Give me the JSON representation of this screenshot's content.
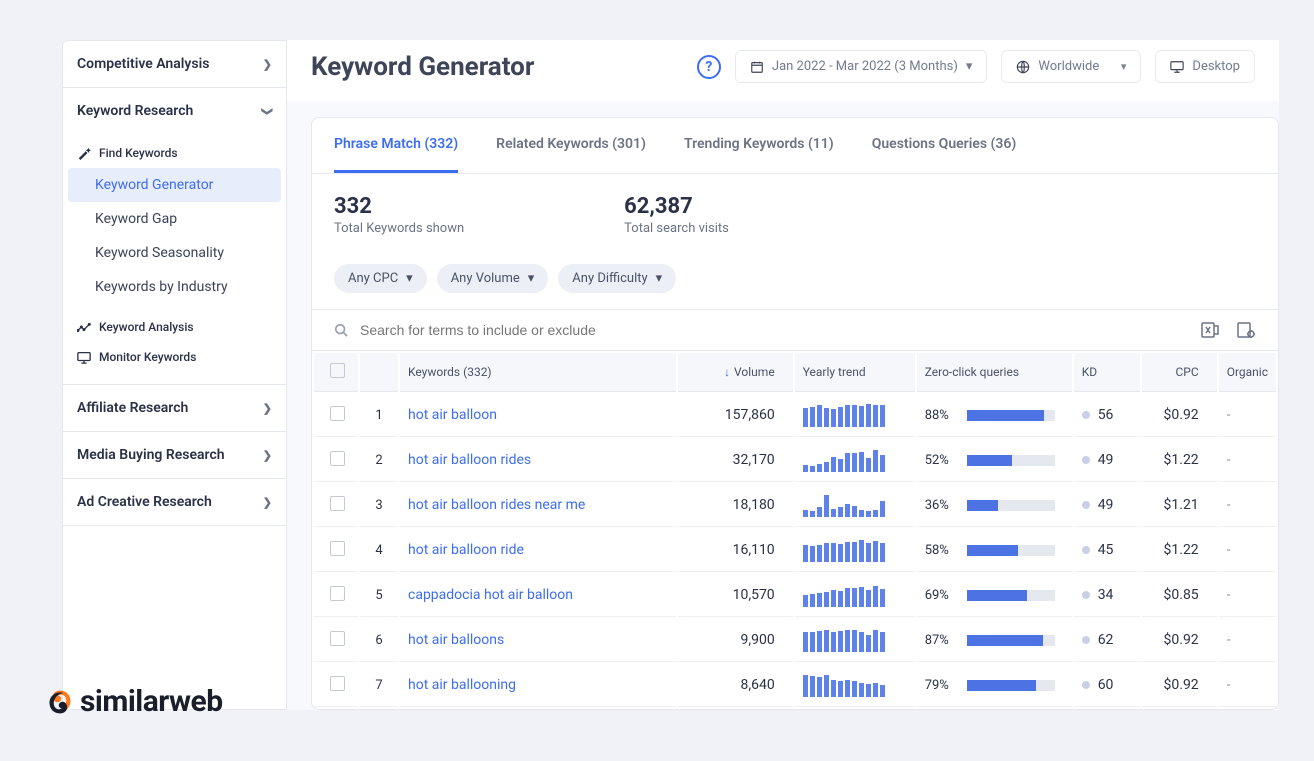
{
  "sidebar": {
    "sections": [
      {
        "label": "Competitive Analysis",
        "expanded": false
      },
      {
        "label": "Keyword Research",
        "expanded": true
      },
      {
        "label": "Affiliate Research",
        "expanded": false
      },
      {
        "label": "Media Buying Research",
        "expanded": false
      },
      {
        "label": "Ad Creative Research",
        "expanded": false
      }
    ],
    "findKeywords": {
      "groupLabel": "Find Keywords",
      "items": [
        "Keyword Generator",
        "Keyword Gap",
        "Keyword Seasonality",
        "Keywords by Industry"
      ],
      "active": "Keyword Generator"
    },
    "keywordAnalysis": "Keyword Analysis",
    "monitorKeywords": "Monitor Keywords"
  },
  "header": {
    "title": "Keyword Generator",
    "dateRange": "Jan 2022 - Mar 2022 (3 Months)",
    "region": "Worldwide",
    "device": "Desktop"
  },
  "tabs": [
    {
      "label": "Phrase Match (332)",
      "active": true
    },
    {
      "label": "Related Keywords (301)",
      "active": false
    },
    {
      "label": "Trending Keywords (11)",
      "active": false
    },
    {
      "label": "Questions Queries (36)",
      "active": false
    }
  ],
  "stats": {
    "totalKeywords": {
      "value": "332",
      "label": "Total Keywords shown"
    },
    "searchVisits": {
      "value": "62,387",
      "label": "Total search visits"
    }
  },
  "filters": [
    "Any CPC",
    "Any Volume",
    "Any Difficulty"
  ],
  "search": {
    "placeholder": "Search for terms to include or exclude"
  },
  "columns": {
    "keywords": "Keywords (332)",
    "volume": "Volume",
    "trend": "Yearly trend",
    "zero": "Zero-click queries",
    "kd": "KD",
    "cpc": "CPC",
    "organic": "Organic"
  },
  "rows": [
    {
      "rank": "1",
      "keyword": "hot air balloon",
      "volume": "157,860",
      "trend": [
        80,
        85,
        90,
        80,
        75,
        85,
        90,
        92,
        88,
        95,
        90,
        92
      ],
      "zero": 88,
      "kd": "56",
      "cpc": "$0.92"
    },
    {
      "rank": "2",
      "keyword": "hot air balloon rides",
      "volume": "32,170",
      "trend": [
        30,
        25,
        35,
        40,
        62,
        55,
        78,
        80,
        85,
        60,
        90,
        70
      ],
      "zero": 52,
      "kd": "49",
      "cpc": "$1.22"
    },
    {
      "rank": "3",
      "keyword": "hot air balloon rides near me",
      "volume": "18,180",
      "trend": [
        30,
        25,
        40,
        90,
        35,
        40,
        55,
        45,
        30,
        25,
        30,
        65
      ],
      "zero": 36,
      "kd": "49",
      "cpc": "$1.21"
    },
    {
      "rank": "4",
      "keyword": "hot air balloon ride",
      "volume": "16,110",
      "trend": [
        70,
        65,
        72,
        78,
        80,
        75,
        82,
        85,
        90,
        78,
        88,
        80
      ],
      "zero": 58,
      "kd": "45",
      "cpc": "$1.22"
    },
    {
      "rank": "5",
      "keyword": "cappadocia hot air balloon",
      "volume": "10,570",
      "trend": [
        50,
        55,
        60,
        62,
        70,
        65,
        78,
        80,
        85,
        72,
        88,
        75
      ],
      "zero": 69,
      "kd": "34",
      "cpc": "$0.85"
    },
    {
      "rank": "6",
      "keyword": "hot air balloons",
      "volume": "9,900",
      "trend": [
        85,
        82,
        88,
        90,
        85,
        88,
        92,
        90,
        85,
        72,
        90,
        85
      ],
      "zero": 87,
      "kd": "62",
      "cpc": "$0.92"
    },
    {
      "rank": "7",
      "keyword": "hot air ballooning",
      "volume": "8,640",
      "trend": [
        90,
        88,
        85,
        90,
        70,
        65,
        72,
        68,
        60,
        55,
        58,
        50
      ],
      "zero": 79,
      "kd": "60",
      "cpc": "$0.92"
    }
  ],
  "brand": "similarweb"
}
